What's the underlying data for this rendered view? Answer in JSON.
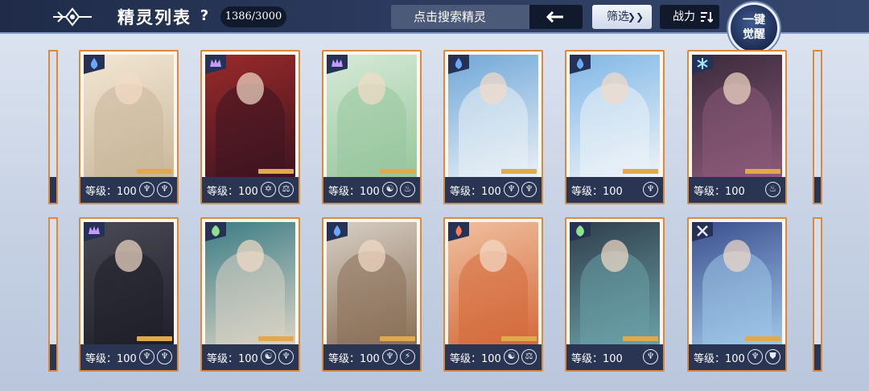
{
  "header": {
    "title": "精灵列表",
    "help": "?",
    "count": "1386/3000",
    "search_placeholder": "点击搜索精灵",
    "filter_label": "筛选",
    "sort_label": "战力",
    "awaken_line1": "一键",
    "awaken_line2": "觉醒"
  },
  "colors": {
    "card_border": "#d98a3c",
    "footer": "#2a3554",
    "topbar": "#2b3a5e"
  },
  "cards": [
    {
      "level": "等级：100",
      "element": "water-icon",
      "tint": [
        "#f3e7d3",
        "#c9b79b"
      ],
      "sk": [
        "♆",
        "♆"
      ]
    },
    {
      "level": "等级：100",
      "element": "dark-crown-icon",
      "tint": [
        "#9a2a2a",
        "#3d1420"
      ],
      "sk": [
        "✡",
        "⚖"
      ]
    },
    {
      "level": "等级：100",
      "element": "dark-crown-icon",
      "tint": [
        "#d6ead8",
        "#97c69c"
      ],
      "sk": [
        "☯",
        "♨"
      ]
    },
    {
      "level": "等级：100",
      "element": "water-icon",
      "tint": [
        "#6fa7d8",
        "#e9f0f5"
      ],
      "sk": [
        "♆",
        "♆"
      ]
    },
    {
      "level": "等级：100",
      "element": "water-icon",
      "tint": [
        "#7fb7e6",
        "#edf3f8"
      ],
      "sk": [
        "♆"
      ]
    },
    {
      "level": "等级：100",
      "element": "ice-icon",
      "tint": [
        "#3a2a3c",
        "#8b5a78"
      ],
      "sk": [
        "♨"
      ]
    },
    {
      "level": "等级：100",
      "element": "dark-crown-icon",
      "tint": [
        "#4a4a56",
        "#1f1f2a"
      ],
      "sk": [
        "♆",
        "♆"
      ]
    },
    {
      "level": "等级：100",
      "element": "grass-icon",
      "tint": [
        "#3a7d86",
        "#d9d2c4"
      ],
      "sk": [
        "☯",
        "♆"
      ]
    },
    {
      "level": "等级：100",
      "element": "water-icon",
      "tint": [
        "#d7cfc5",
        "#8a6f57"
      ],
      "sk": [
        "♆",
        "⚡"
      ]
    },
    {
      "level": "等级：100",
      "element": "fire-icon",
      "tint": [
        "#f0c0a0",
        "#d46a3a"
      ],
      "sk": [
        "☯",
        "⚖"
      ]
    },
    {
      "level": "等级：100",
      "element": "grass-icon",
      "tint": [
        "#2f3e4a",
        "#6aa0a8"
      ],
      "sk": [
        "♆"
      ]
    },
    {
      "level": "等级：100",
      "element": "normal-icon",
      "tint": [
        "#3b4f8f",
        "#9fc6e8"
      ],
      "sk": [
        "♆",
        "⛊"
      ]
    }
  ]
}
